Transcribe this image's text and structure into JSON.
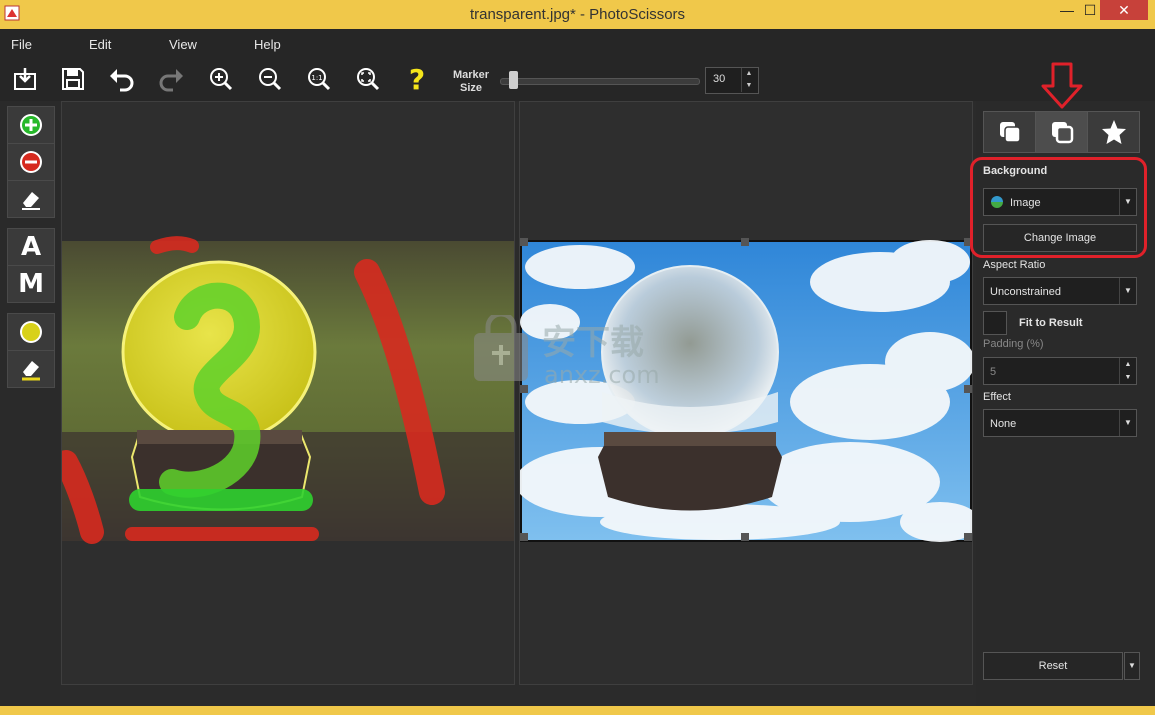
{
  "window": {
    "title": "transparent.jpg* - PhotoScissors",
    "minimize": "—",
    "maximize": "☐",
    "close": "✕"
  },
  "menu": [
    "File",
    "Edit",
    "View",
    "Help"
  ],
  "toolbar": {
    "marker_label_line1": "Marker",
    "marker_label_line2": "Size",
    "marker_size": "30",
    "marker_level_fraction": 0.05
  },
  "left_tools": {
    "auto_letter": "A",
    "manual_letter": "M"
  },
  "right_panel": {
    "background_label": "Background",
    "background_value": "Image",
    "change_image_label": "Change Image",
    "aspect_ratio_label": "Aspect Ratio",
    "aspect_ratio_value": "Unconstrained",
    "fit_to_result_label": "Fit to Result",
    "padding_label": "Padding (%)",
    "padding_value": "5",
    "effect_label": "Effect",
    "effect_value": "None",
    "reset_label": "Reset"
  },
  "watermark": {
    "cn": "安下载",
    "url": "anxz.com"
  },
  "colors": {
    "titlebar": "#f0c84a",
    "accent_red": "#e0212a",
    "foreground_marker": "#2fd12f",
    "background_marker": "#d62a1f"
  }
}
